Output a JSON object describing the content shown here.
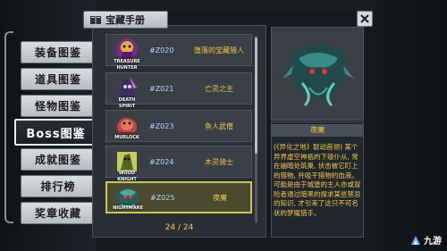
{
  "header": {
    "title": "宝藏手册"
  },
  "nav": {
    "items": [
      {
        "label": "装备图鉴"
      },
      {
        "label": "道具图鉴"
      },
      {
        "label": "怪物图鉴"
      },
      {
        "label": "Boss图鉴"
      },
      {
        "label": "成就图鉴"
      },
      {
        "label": "排行榜"
      },
      {
        "label": "奖章收藏"
      }
    ]
  },
  "list": {
    "items": [
      {
        "code": "#Z020",
        "name": "堕落的宝藏猎人",
        "tag": "TREASURE HUNTER"
      },
      {
        "code": "#Z021",
        "name": "亡灵之主",
        "tag": "DEATH SPIRIT"
      },
      {
        "code": "#Z023",
        "name": "鱼人武僧",
        "tag": "MURLOCK"
      },
      {
        "code": "#Z024",
        "name": "木灵骑士",
        "tag": "WOOD KNIGHT"
      },
      {
        "code": "#Z025",
        "name": "夜魔",
        "tag": "NIGHTMARE"
      }
    ],
    "page_counter": "24 / 24"
  },
  "detail": {
    "title": "夜魔",
    "description": "(《异化之地》联动首领) 某个异界虚空神祇的下级仆从, 常在幽暗处筑巢, 伏击被它盯上的猎物, 并吸干猎物的血液。可能是由于城堡的主人亦或冒险者通过暗黑的探求某些禁忌的知识, 才引来了这只不可名状的梦魇猎手。"
  },
  "watermark": {
    "text": "九游"
  },
  "colors": {
    "accent_gold": "#f2c84b",
    "selected_border": "#c9c85a",
    "code_blue": "#b7d5ff"
  }
}
